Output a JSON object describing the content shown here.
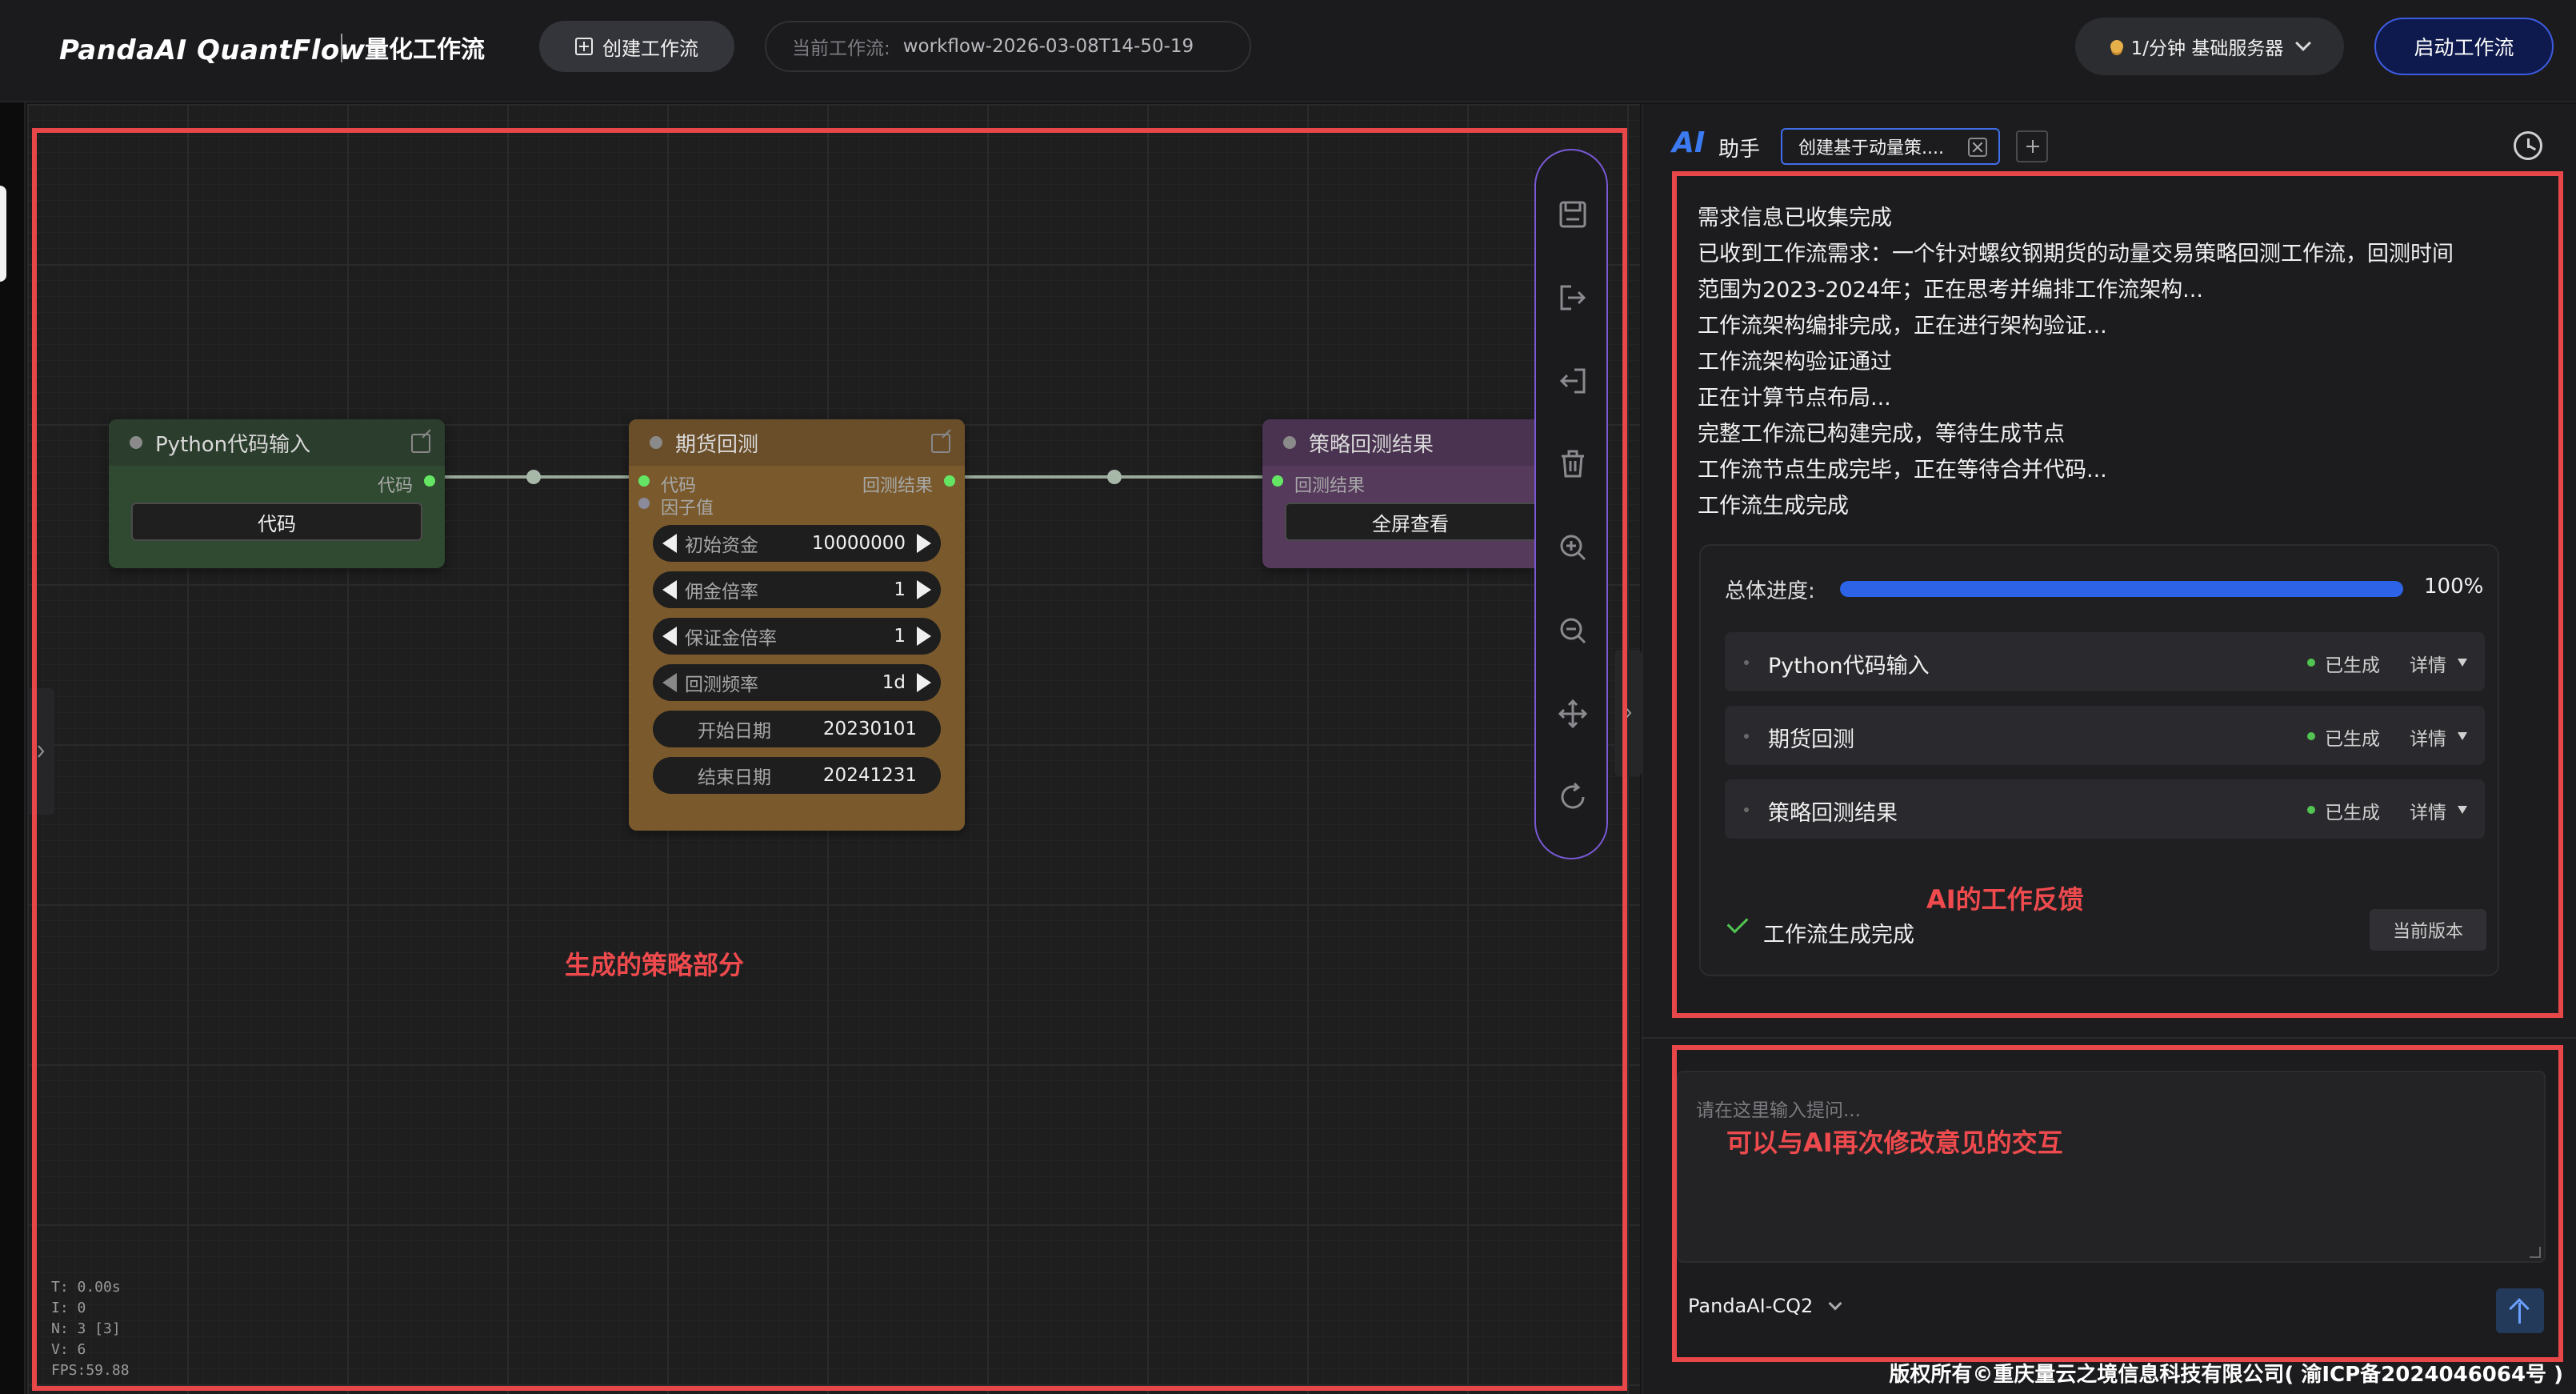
{
  "header": {
    "brand": "PandaAI QuantFlow",
    "subtitle": "量化工作流",
    "create_label": "创建工作流",
    "current_key": "当前工作流:",
    "current_value": "workflow-2026-03-08T14-50-19",
    "server_label": "1/分钟  基础服务器",
    "start_label": "启动工作流"
  },
  "canvas": {
    "annotation": "生成的策略部分",
    "nodes": {
      "python": {
        "title": "Python代码输入",
        "output_slot": "代码",
        "field": "代码"
      },
      "futures": {
        "title": "期货回测",
        "in_code": "代码",
        "in_factor": "因子值",
        "out_result": "回测结果",
        "params": [
          {
            "label": "初始资金",
            "value": "10000000"
          },
          {
            "label": "佣金倍率",
            "value": "1"
          },
          {
            "label": "保证金倍率",
            "value": "1"
          },
          {
            "label": "回测频率",
            "value": "1d"
          },
          {
            "label": "开始日期",
            "value": "20230101"
          },
          {
            "label": "结束日期",
            "value": "20241231"
          }
        ]
      },
      "result": {
        "title": "策略回测结果",
        "in_slot": "回测结果",
        "button": "全屏查看"
      }
    },
    "stats": [
      "T: 0.00s",
      "I: 0",
      "N: 3 [3]",
      "V: 6",
      "FPS:59.88"
    ]
  },
  "assistant": {
    "logo": "AI",
    "title": "助手",
    "tab_label": "创建基于动量策....",
    "messages": [
      "需求信息已收集完成",
      "已收到工作流需求：一个针对螺纹钢期货的动量交易策略回测工作流，回测时间",
      "范围为2023-2024年；正在思考并编排工作流架构...",
      "工作流架构编排完成，正在进行架构验证...",
      "工作流架构验证通过",
      "正在计算节点布局...",
      "完整工作流已构建完成，等待生成节点",
      "工作流节点生成完毕，正在等待合并代码...",
      "工作流生成完成"
    ],
    "progress": {
      "label": "总体进度:",
      "percent_text": "100%",
      "fraction": 1.0,
      "steps": [
        {
          "name": "Python代码输入",
          "status": "已生成",
          "detail": "详情"
        },
        {
          "name": "期货回测",
          "status": "已生成",
          "detail": "详情"
        },
        {
          "name": "策略回测结果",
          "status": "已生成",
          "detail": "详情"
        }
      ],
      "done_text": "工作流生成完成",
      "version_label": "当前版本"
    },
    "feedback_annotation": "AI的工作反馈",
    "input": {
      "placeholder": "请在这里输入提问...",
      "annotation": "可以与AI再次修改意见的交互",
      "model": "PandaAI-CQ2"
    }
  },
  "footer": "版权所有©重庆量云之境信息科技有限公司( 渝ICP备2024046064号 )",
  "colors": {
    "accent": "#3d5be0",
    "annotation_red": "#e8474a",
    "python_node": "#2f4a30",
    "futures_node": "#7a5a2c",
    "result_node": "#553a5c",
    "status_green": "#52c452"
  }
}
